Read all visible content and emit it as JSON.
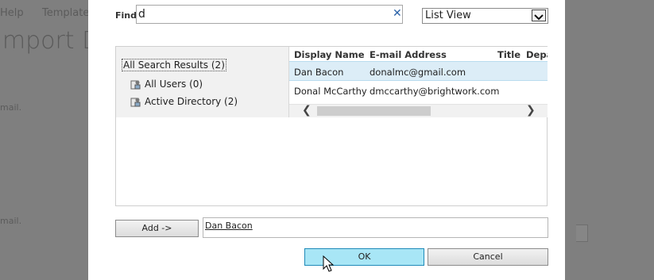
{
  "background": {
    "nav_help": "Help",
    "nav_templates": "Templates",
    "page_title": "Import Data",
    "hint_1": "mail.",
    "hint_2": "mail."
  },
  "dialog": {
    "find_label": "Find",
    "find_value": "d",
    "clear_icon": "close-icon",
    "view_select": "List View",
    "tree": {
      "root": "All Search Results (2)",
      "nodes": [
        "All Users (0)",
        "Active Directory (2)"
      ]
    },
    "grid": {
      "columns": [
        "Display Name",
        "E-mail Address",
        "Title",
        "Depa"
      ],
      "rows": [
        {
          "name": "Dan Bacon",
          "email": "donalmc@gmail.com",
          "selected": true
        },
        {
          "name": "Donal McCarthy",
          "email": "dmccarthy@brightwork.com",
          "selected": false
        }
      ]
    },
    "add_label": "Add ->",
    "selected_people": [
      "Dan Bacon"
    ],
    "ok_label": "OK",
    "cancel_label": "Cancel"
  },
  "colors": {
    "overlay": "#7f7f7f",
    "selected_row": "#dcedf7",
    "ok_button": "#a8e6f6",
    "link_blue": "#2a62a8"
  }
}
